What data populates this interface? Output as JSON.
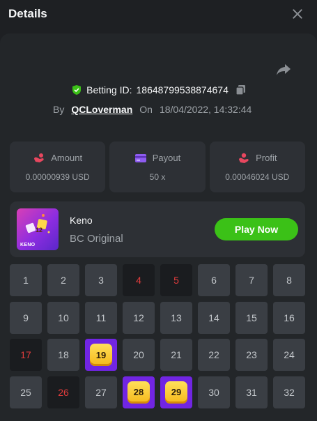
{
  "header": {
    "title": "Details"
  },
  "bet": {
    "id_label": "Betting ID:",
    "id_value": "1864879953887467​4",
    "by_label": "By",
    "user": "QCLoverman",
    "on_label": "On",
    "datetime": "18/04/2022, 14:32:44"
  },
  "stats": [
    {
      "label": "Amount",
      "value": "0.00000939 USD",
      "icon": "coins-icon"
    },
    {
      "label": "Payout",
      "value": "50 x",
      "icon": "card-icon"
    },
    {
      "label": "Profit",
      "value": "0.00046024 USD",
      "icon": "profit-icon"
    }
  ],
  "game": {
    "name": "Keno",
    "subtitle": "BC Original",
    "thumb_text": "KENO",
    "thumb_tile": "12",
    "play_label": "Play Now"
  },
  "grid": {
    "numbers": [
      "1",
      "2",
      "3",
      "4",
      "5",
      "6",
      "7",
      "8",
      "9",
      "10",
      "11",
      "12",
      "13",
      "14",
      "15",
      "16",
      "17",
      "18",
      "19",
      "20",
      "21",
      "22",
      "23",
      "24",
      "25",
      "26",
      "27",
      "28",
      "29",
      "30",
      "31",
      "32"
    ],
    "picked": [
      4,
      5,
      17,
      26
    ],
    "hits": [
      19,
      28,
      29
    ]
  },
  "colors": {
    "accent_green": "#3bc117",
    "hit_purple": "#7125e3",
    "pick_red": "#e23c3c",
    "shield_green": "#3bc117"
  }
}
